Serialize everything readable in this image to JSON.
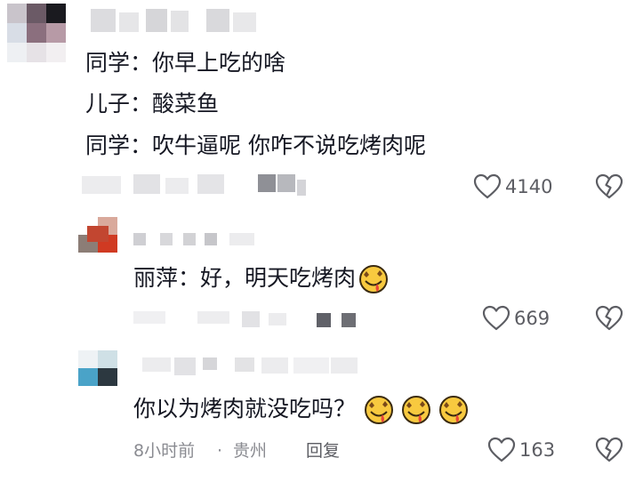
{
  "comment1": {
    "lines": [
      "同学：你早上吃的啥",
      "儿子：酸菜鱼",
      "同学：吹牛逼呢 你咋不说吃烤肉呢"
    ],
    "likes": "4140",
    "like_icon": "heart-outline-icon",
    "dislike_icon": "broken-heart-icon"
  },
  "reply1": {
    "text": "丽萍：好，明天吃烤肉",
    "emoji": [
      "drooling-face-emoji"
    ],
    "likes": "669"
  },
  "reply2": {
    "text": "你以为烤肉就没吃吗？",
    "emoji": [
      "drooling-face-emoji",
      "drooling-face-emoji",
      "drooling-face-emoji"
    ],
    "time": "8小时前",
    "separator": "·",
    "location": "贵州",
    "reply_label": "回复",
    "likes": "163"
  },
  "colors": {
    "text": "#161823",
    "meta": "#8a8b91",
    "icon": "#5c5d63",
    "censor": "#d9d9dc"
  }
}
